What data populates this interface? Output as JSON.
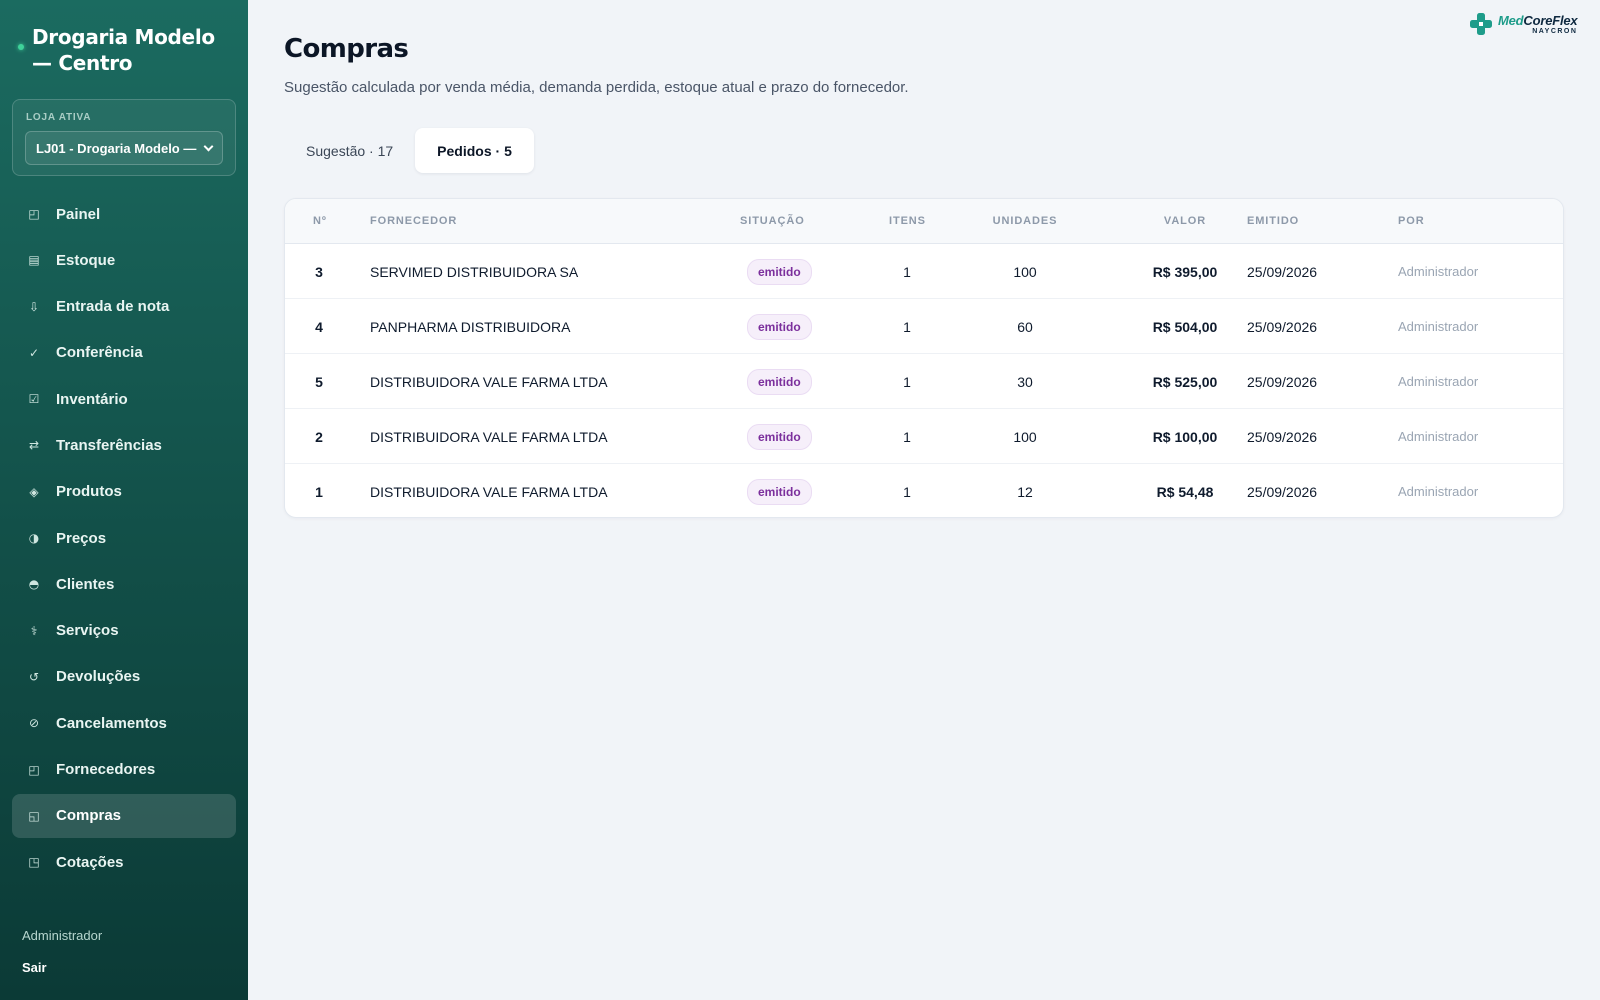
{
  "sidebar": {
    "brand_title": "Drogaria Modelo — Centro",
    "store_label": "LOJA ATIVA",
    "store_value": "LJ01 - Drogaria Modelo —",
    "items": [
      {
        "label": "Painel",
        "icon": "◰"
      },
      {
        "label": "Estoque",
        "icon": "▤"
      },
      {
        "label": "Entrada de nota",
        "icon": "⇩"
      },
      {
        "label": "Conferência",
        "icon": "✓"
      },
      {
        "label": "Inventário",
        "icon": "☑"
      },
      {
        "label": "Transferências",
        "icon": "⇄"
      },
      {
        "label": "Produtos",
        "icon": "◈"
      },
      {
        "label": "Preços",
        "icon": "◑"
      },
      {
        "label": "Clientes",
        "icon": "◓"
      },
      {
        "label": "Serviços",
        "icon": "⚕"
      },
      {
        "label": "Devoluções",
        "icon": "↺"
      },
      {
        "label": "Cancelamentos",
        "icon": "⊘"
      },
      {
        "label": "Fornecedores",
        "icon": "◰"
      },
      {
        "label": "Compras",
        "icon": "◱"
      },
      {
        "label": "Cotações",
        "icon": "◳"
      }
    ],
    "active_item": "Compras",
    "user_name": "Administrador",
    "logout_label": "Sair"
  },
  "logo": {
    "name_a": "Med",
    "name_b": "CoreFlex",
    "sub": "NAYCRON"
  },
  "page": {
    "title": "Compras",
    "subtitle": "Sugestão calculada por venda média, demanda perdida, estoque atual e prazo do fornecedor."
  },
  "tabs": [
    {
      "label": "Sugestão · 17",
      "active": false
    },
    {
      "label": "Pedidos · 5",
      "active": true
    }
  ],
  "table": {
    "columns": [
      "Nº",
      "FORNECEDOR",
      "SITUAÇÃO",
      "ITENS",
      "UNIDADES",
      "VALOR",
      "EMITIDO",
      "POR"
    ],
    "rows": [
      {
        "num": "3",
        "supplier": "SERVIMED DISTRIBUIDORA SA",
        "status": "emitido",
        "items": "1",
        "units": "100",
        "value": "R$ 395,00",
        "issued": "25/09/2026",
        "by": "Administrador"
      },
      {
        "num": "4",
        "supplier": "PANPHARMA DISTRIBUIDORA",
        "status": "emitido",
        "items": "1",
        "units": "60",
        "value": "R$ 504,00",
        "issued": "25/09/2026",
        "by": "Administrador"
      },
      {
        "num": "5",
        "supplier": "DISTRIBUIDORA VALE FARMA LTDA",
        "status": "emitido",
        "items": "1",
        "units": "30",
        "value": "R$ 525,00",
        "issued": "25/09/2026",
        "by": "Administrador"
      },
      {
        "num": "2",
        "supplier": "DISTRIBUIDORA VALE FARMA LTDA",
        "status": "emitido",
        "items": "1",
        "units": "100",
        "value": "R$ 100,00",
        "issued": "25/09/2026",
        "by": "Administrador"
      },
      {
        "num": "1",
        "supplier": "DISTRIBUIDORA VALE FARMA LTDA",
        "status": "emitido",
        "items": "1",
        "units": "12",
        "value": "R$ 54,48",
        "issued": "25/09/2026",
        "by": "Administrador"
      }
    ]
  },
  "colors": {
    "sidebar_top": "#1b6b60",
    "sidebar_bottom": "#0b3a36",
    "status_badge": "#7b2f9c",
    "brand_accent": "#1e9c8a"
  }
}
